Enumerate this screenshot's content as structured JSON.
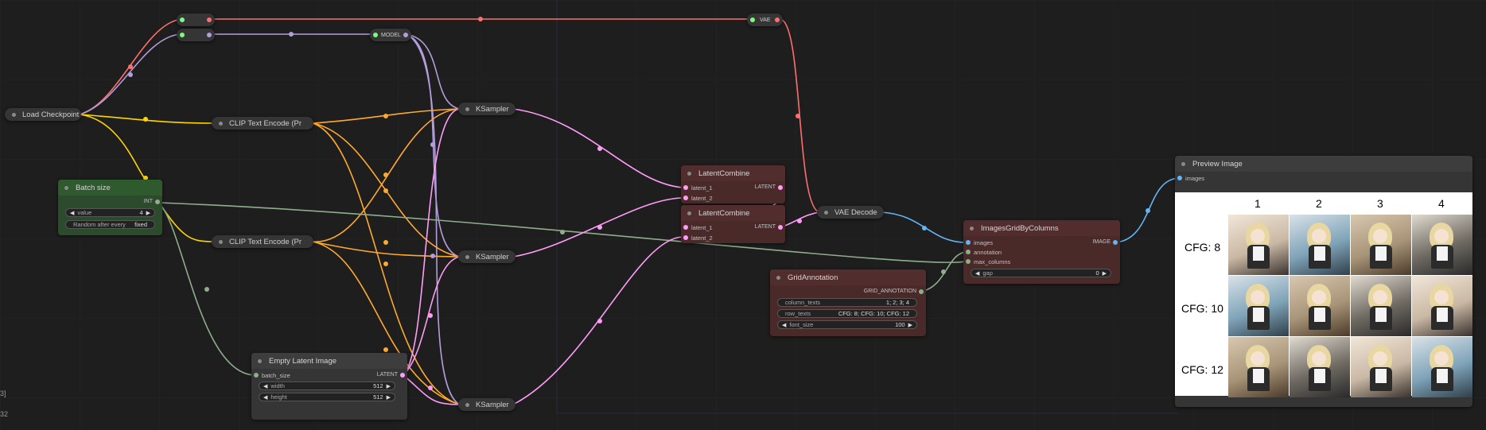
{
  "nodes": {
    "reroute_top1": {
      "label": ""
    },
    "reroute_top2": {
      "label": ""
    },
    "reroute_model": {
      "label": "MODEL"
    },
    "reroute_vae": {
      "label": "VAE"
    },
    "load_checkpoint": {
      "title": "Load Checkpoint"
    },
    "clip_encode_1": {
      "title": "CLIP Text Encode (Pr"
    },
    "clip_encode_2": {
      "title": "CLIP Text Encode (Pr"
    },
    "batch_size": {
      "title": "Batch size",
      "output": "INT",
      "value_label": "value",
      "value": "4",
      "control_label": "Random after every",
      "control_value": "fixed"
    },
    "ksampler_1": {
      "title": "KSampler"
    },
    "ksampler_2": {
      "title": "KSampler"
    },
    "ksampler_3": {
      "title": "KSampler"
    },
    "latent_combine_1": {
      "title": "LatentCombine",
      "in1": "latent_1",
      "in2": "latent_2",
      "out": "LATENT"
    },
    "latent_combine_2": {
      "title": "LatentCombine",
      "in1": "latent_1",
      "in2": "latent_2",
      "out": "LATENT"
    },
    "vae_decode": {
      "title": "VAE Decode"
    },
    "empty_latent": {
      "title": "Empty Latent Image",
      "in": "batch_size",
      "out": "LATENT",
      "width_label": "width",
      "width": "512",
      "height_label": "height",
      "height": "512"
    },
    "grid_annotation": {
      "title": "GridAnnotation",
      "out": "GRID_ANNOTATION",
      "column_texts_label": "column_texts",
      "column_texts": "1; 2; 3; 4",
      "row_texts_label": "row_texts",
      "row_texts": "CFG: 8; CFG: 10; CFG: 12",
      "font_size_label": "font_size",
      "font_size": "100"
    },
    "images_grid": {
      "title": "ImagesGridByColumns",
      "in_images": "images",
      "in_annotation": "annotation",
      "in_max_columns": "max_columns",
      "out": "IMAGE",
      "gap_label": "gap",
      "gap": "0"
    },
    "preview": {
      "title": "Preview Image",
      "in": "images",
      "columns": [
        "1",
        "2",
        "3",
        "4"
      ],
      "rows": [
        "CFG: 8",
        "CFG: 10",
        "CFG: 12"
      ]
    }
  },
  "edge_text": {
    "a": "3]",
    "b": "32"
  },
  "colors": {
    "clip": "#ffd500",
    "model": "#b39ddb",
    "vae": "#ff6e6e",
    "conditioning": "#ffa931",
    "latent": "#ff9cf9",
    "int": "#8fae8c",
    "image": "#64b5f6",
    "annotation": "#aaaaaa"
  }
}
